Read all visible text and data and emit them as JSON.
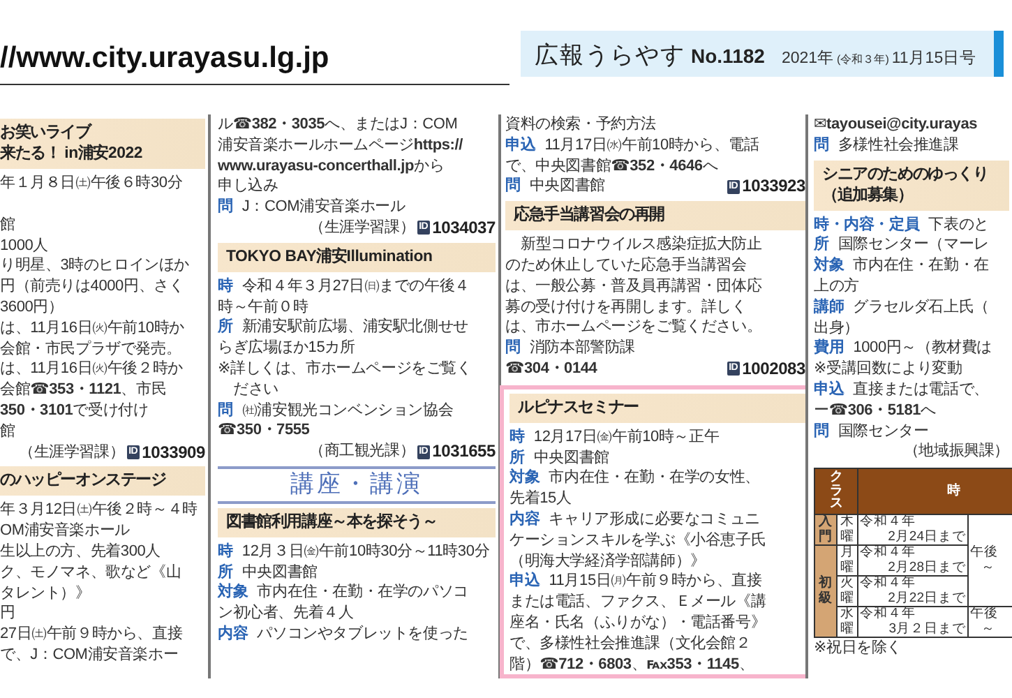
{
  "header": {
    "url": "//www.city.urayasu.lg.jp",
    "logo": "広報うらやす",
    "issue_no": "No.1182",
    "date_year": "2021年",
    "date_era": "(令和３年)",
    "date_day": "11月15日号"
  },
  "columns": [
    {
      "sections": [
        {
          "boxed": false,
          "items": [
            {
              "kind": "heading",
              "lines": [
                "お笑いライブ",
                "来たる！ in浦安2022"
              ]
            },
            {
              "kind": "line",
              "text": "年１月８日㈯午後６時30分"
            },
            {
              "kind": "gap"
            },
            {
              "kind": "line",
              "text": "館"
            },
            {
              "kind": "line",
              "text": "1000人"
            },
            {
              "kind": "line",
              "text": "り明星、3時のヒロインほか"
            },
            {
              "kind": "line",
              "text": "円（前売りは4000円、さく"
            },
            {
              "kind": "line",
              "text": "3600円）"
            },
            {
              "kind": "line",
              "text": "は、11月16日㈫午前10時か"
            },
            {
              "kind": "line",
              "text": "会館・市民プラザで発売。"
            },
            {
              "kind": "line",
              "text": "は、11月16日㈫午後２時か"
            },
            {
              "kind": "line",
              "text": "会館**☎353・1121**、市民"
            },
            {
              "kind": "line",
              "text": "**350・3101**で受け付け"
            },
            {
              "kind": "line",
              "text": "館"
            },
            {
              "kind": "ref",
              "note": "（生涯学習課）",
              "badge": "ID",
              "id": "1033909"
            },
            {
              "kind": "heading",
              "lines": [
                "のハッピーオンステージ"
              ]
            },
            {
              "kind": "line",
              "text": "年３月12日㈯午後２時～４時"
            },
            {
              "kind": "line",
              "text": "OM浦安音楽ホール"
            },
            {
              "kind": "line",
              "text": "生以上の方、先着300人"
            },
            {
              "kind": "line",
              "text": "ク、モノマネ、歌など《山"
            },
            {
              "kind": "line",
              "text": "タレント）》"
            },
            {
              "kind": "line",
              "text": "円"
            },
            {
              "kind": "line",
              "text": "27日㈯午前９時から、直接"
            },
            {
              "kind": "line",
              "text": "で、J：COM浦安音楽ホー"
            }
          ]
        }
      ]
    },
    {
      "sections": [
        {
          "boxed": false,
          "items": [
            {
              "kind": "line",
              "text": "ル**☎382・3035**へ、またはJ：COM"
            },
            {
              "kind": "line",
              "text": "浦安音楽ホールホームページ**https://**"
            },
            {
              "kind": "line",
              "text": "**www.urayasu-concerthall.jp**から"
            },
            {
              "kind": "line",
              "text": "申し込み"
            },
            {
              "kind": "line",
              "label": "問",
              "text": "J：COM浦安音楽ホール"
            },
            {
              "kind": "ref",
              "note": "（生涯学習課）",
              "badge": "ID",
              "id": "1034037"
            },
            {
              "kind": "heading",
              "lines": [
                "TOKYO BAY浦安Illumination"
              ]
            },
            {
              "kind": "line",
              "label": "時",
              "text": "令和４年３月27日㈰までの午後４"
            },
            {
              "kind": "line",
              "text": "時～午前０時"
            },
            {
              "kind": "line",
              "label": "所",
              "text": "新浦安駅前広場、浦安駅北側せせ"
            },
            {
              "kind": "line",
              "text": "らぎ広場ほか15カ所"
            },
            {
              "kind": "line",
              "text": "※詳しくは、市ホームページをご覧く"
            },
            {
              "kind": "line",
              "indent": true,
              "text": "ださい"
            },
            {
              "kind": "line",
              "label": "問",
              "text": "㈳浦安観光コンベンション協会"
            },
            {
              "kind": "line",
              "text": "**☎350・7555**"
            },
            {
              "kind": "ref",
              "note": "（商工観光課）",
              "badge": "ID",
              "id": "1031655"
            },
            {
              "kind": "banner",
              "text": "講座・講演"
            },
            {
              "kind": "heading",
              "lines": [
                "図書館利用講座～本を探そう～"
              ]
            },
            {
              "kind": "line",
              "label": "時",
              "text": "12月３日㈮午前10時30分～11時30分"
            },
            {
              "kind": "line",
              "label": "所",
              "text": "中央図書館"
            },
            {
              "kind": "line",
              "label": "対象",
              "text": "市内在住・在勤・在学のパソコ"
            },
            {
              "kind": "line",
              "text": "ン初心者、先着４人"
            },
            {
              "kind": "line",
              "label": "内容",
              "text": "パソコンやタブレットを使った"
            }
          ]
        }
      ]
    },
    {
      "sections": [
        {
          "boxed": false,
          "items": [
            {
              "kind": "line",
              "text": "資料の検索・予約方法"
            },
            {
              "kind": "line",
              "label": "申込",
              "text": "11月17日㈬午前10時から、電話"
            },
            {
              "kind": "line",
              "text": "で、中央図書館**☎352・4646**へ"
            },
            {
              "kind": "ref",
              "label": "問",
              "text": "中央図書館",
              "badge": "ID",
              "id": "1033923"
            },
            {
              "kind": "heading",
              "lines": [
                "応急手当講習会の再開"
              ]
            },
            {
              "kind": "line",
              "indent": true,
              "text": "新型コロナウイルス感染症拡大防止"
            },
            {
              "kind": "line",
              "text": "のため休止していた応急手当講習会"
            },
            {
              "kind": "line",
              "text": "は、一般公募・普及員再講習・団体応"
            },
            {
              "kind": "line",
              "text": "募の受け付けを再開します。詳しく"
            },
            {
              "kind": "line",
              "text": "は、市ホームページをご覧ください。"
            },
            {
              "kind": "line",
              "label": "問",
              "text": "消防本部警防課"
            },
            {
              "kind": "ref",
              "text": "**☎304・0144**",
              "badge": "ID",
              "id": "1002083"
            }
          ]
        },
        {
          "boxed": true,
          "items": [
            {
              "kind": "heading",
              "lines": [
                "ルピナスセミナー"
              ]
            },
            {
              "kind": "line",
              "label": "時",
              "text": "12月17日㈮午前10時～正午"
            },
            {
              "kind": "line",
              "label": "所",
              "text": "中央図書館"
            },
            {
              "kind": "line",
              "label": "対象",
              "text": "市内在住・在勤・在学の女性、"
            },
            {
              "kind": "line",
              "text": "先着15人"
            },
            {
              "kind": "line",
              "label": "内容",
              "text": "キャリア形成に必要なコミュニ"
            },
            {
              "kind": "line",
              "text": "ケーションスキルを学ぶ《小谷恵子氏"
            },
            {
              "kind": "line",
              "text": "（明海大学経済学部講師）》"
            },
            {
              "kind": "line",
              "label": "申込",
              "text": "11月15日㈪午前９時から、直接"
            },
            {
              "kind": "line",
              "text": "または電話、ファクス、Ｅメール《講"
            },
            {
              "kind": "line",
              "text": "座名・氏名（ふりがな）・電話番号》"
            },
            {
              "kind": "line",
              "text": "で、多様性社会推進課（文化会館２"
            },
            {
              "kind": "line",
              "text": "階）**☎712・6803**、**℻353・1145**、"
            }
          ]
        }
      ]
    },
    {
      "sections": [
        {
          "boxed": false,
          "items": [
            {
              "kind": "line",
              "text": "✉**tayousei@city.urayas**"
            },
            {
              "kind": "line",
              "label": "問",
              "text": "多様性社会推進課"
            },
            {
              "kind": "heading",
              "lines": [
                "シニアのためのゆっくり",
                "（追加募集）"
              ]
            },
            {
              "kind": "line",
              "label": "時・内容・定員",
              "text": "下表のと"
            },
            {
              "kind": "line",
              "label": "所",
              "text": "国際センター（マーレ"
            },
            {
              "kind": "line",
              "label": "対象",
              "text": "市内在住・在勤・在"
            },
            {
              "kind": "line",
              "text": "上の方"
            },
            {
              "kind": "line",
              "label": "講師",
              "text": "グラセルダ石上氏（"
            },
            {
              "kind": "line",
              "text": "出身）"
            },
            {
              "kind": "line",
              "label": "費用",
              "text": "1000円～（教材費は"
            },
            {
              "kind": "line",
              "text": "※受講回数により変動"
            },
            {
              "kind": "line",
              "label": "申込",
              "text": "直接または電話で、"
            },
            {
              "kind": "line",
              "text": "ー**☎306・5181**へ"
            },
            {
              "kind": "line",
              "label": "問",
              "text": "国際センター"
            },
            {
              "kind": "ref",
              "note": "（地域振興課）"
            },
            {
              "kind": "table",
              "header": {
                "class": "クラス",
                "time": "時"
              },
              "groups": [
                {
                  "name": "入門",
                  "rows": [
                    {
                      "day": "木曜",
                      "until": [
                        "令和４年",
                        "2月24日まで"
                      ],
                      "time": [
                        "午後",
                        "～"
                      ]
                    }
                  ]
                },
                {
                  "name": "初級",
                  "rows": [
                    {
                      "day": "月曜",
                      "until": [
                        "令和４年",
                        "2月28日まで"
                      ]
                    },
                    {
                      "day": "火曜",
                      "until": [
                        "令和４年",
                        "2月22日まで"
                      ]
                    },
                    {
                      "day": "水曜",
                      "until": [
                        "令和４年",
                        "3月２日まで"
                      ],
                      "time": [
                        "午後",
                        "～"
                      ]
                    }
                  ]
                }
              ]
            },
            {
              "kind": "line",
              "text": "※祝日を除く"
            }
          ]
        }
      ]
    }
  ]
}
